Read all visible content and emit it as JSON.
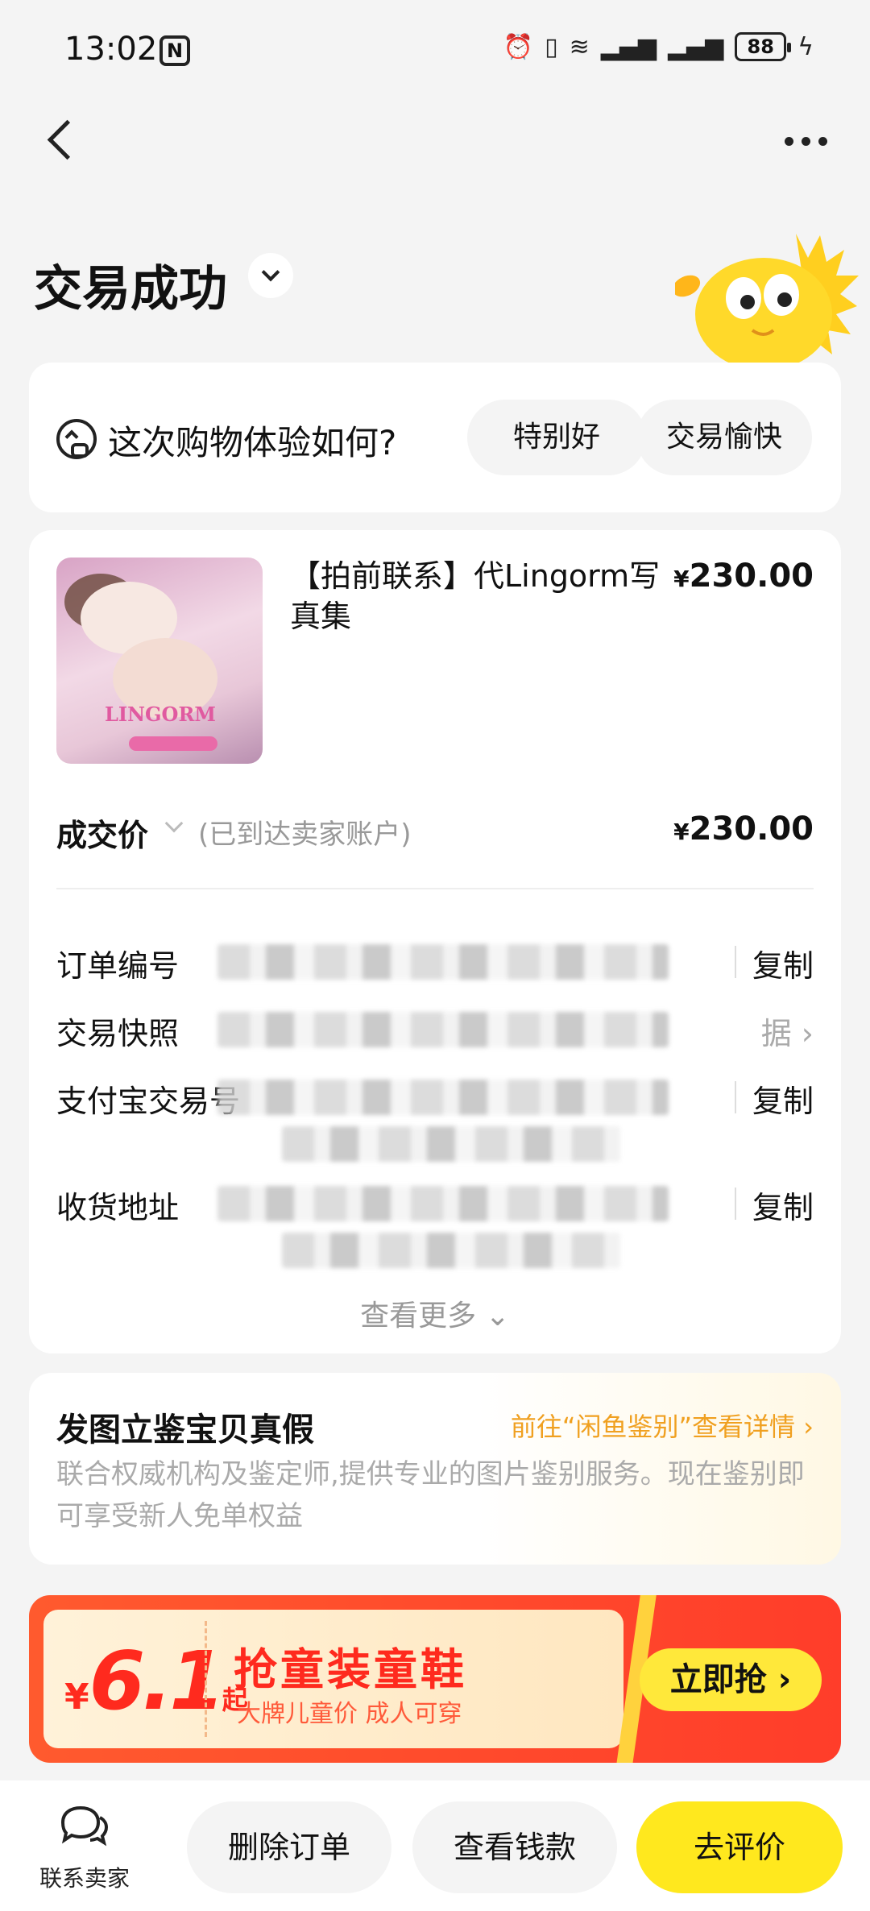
{
  "status_bar": {
    "time": "13:02",
    "battery": "88"
  },
  "header": {
    "title": "交易成功"
  },
  "rating": {
    "question": "这次购物体验如何?",
    "options": [
      "特别好",
      "交易愉快"
    ]
  },
  "product": {
    "title": "【拍前联系】代Lingorm写真集",
    "price_symbol": "¥",
    "price": "230.00",
    "image_text": "LINGORM"
  },
  "deal": {
    "label": "成交价",
    "note": "(已到达卖家账户)",
    "price_symbol": "¥",
    "price": "230.00"
  },
  "order_info": [
    {
      "label": "订单编号",
      "action": "复制"
    },
    {
      "label": "交易快照",
      "action": "据 ›"
    },
    {
      "label": "支付宝交易号",
      "action": "复制"
    },
    {
      "label": "收货地址",
      "action": "复制"
    }
  ],
  "see_more": "查看更多",
  "appraise": {
    "title": "发图立鉴宝贝真假",
    "link": "前往“闲鱼鉴别”查看详情 ›",
    "description": "联合权威机构及鉴定师,提供专业的图片鉴别服务。现在鉴别即可享受新人免单权益"
  },
  "promo": {
    "price_symbol": "¥",
    "price": "6.1",
    "price_unit": "起",
    "title": "抢童装童鞋",
    "subtitle": "大牌儿童价 成人可穿",
    "cta": "立即抢 ›"
  },
  "bottom_bar": {
    "contact": "联系卖家",
    "delete": "删除订单",
    "money": "查看钱款",
    "review": "去评价"
  },
  "colors": {
    "accent": "#ffe81e",
    "promo_red": "#ff3d2a",
    "link_orange": "#f0a020"
  }
}
